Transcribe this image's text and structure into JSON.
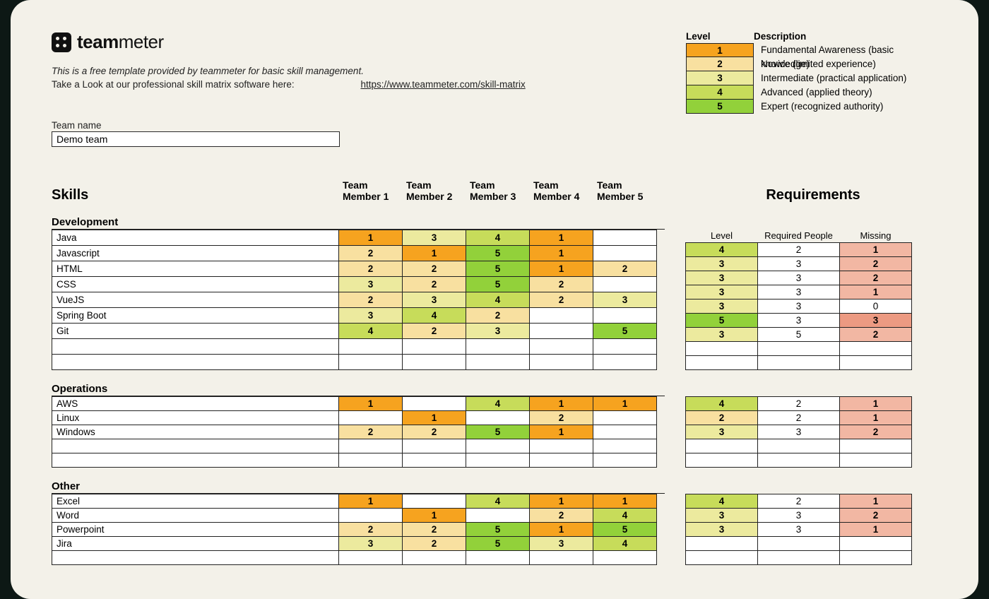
{
  "brand": {
    "bold": "team",
    "light": "meter"
  },
  "intro": {
    "tagline": "This is a free template provided by teammeter for basic skill management.",
    "lookline": "Take a Look at our professional skill matrix software here:",
    "link_text": "https://www.teammeter.com/skill-matrix"
  },
  "team": {
    "label": "Team name",
    "value": "Demo team"
  },
  "legend": {
    "head_level": "Level",
    "head_desc": "Description",
    "rows": [
      {
        "level": "1",
        "desc": "Fundamental Awareness (basic knowledge)",
        "cls": "lv1"
      },
      {
        "level": "2",
        "desc": "Novice (limited experience)",
        "cls": "lv2"
      },
      {
        "level": "3",
        "desc": "Intermediate (practical application)",
        "cls": "lv3"
      },
      {
        "level": "4",
        "desc": "Advanced (applied theory)",
        "cls": "lv4"
      },
      {
        "level": "5",
        "desc": "Expert (recognized authority)",
        "cls": "lv5"
      }
    ]
  },
  "headers": {
    "skills": "Skills",
    "requirements": "Requirements",
    "members": [
      "Team Member 1",
      "Team Member 2",
      "Team Member 3",
      "Team Member 4",
      "Team Member 5"
    ],
    "req_cols": [
      "Level",
      "Required People",
      "Missing"
    ]
  },
  "sections": [
    {
      "name": "Development",
      "rows": [
        {
          "skill": "Java",
          "cells": [
            "1",
            "3",
            "4",
            "1",
            ""
          ],
          "req": [
            "4",
            "2",
            "1"
          ],
          "miss": "miss"
        },
        {
          "skill": "Javascript",
          "cells": [
            "2",
            "1",
            "5",
            "1",
            ""
          ],
          "req": [
            "3",
            "3",
            "2"
          ],
          "miss": "miss"
        },
        {
          "skill": "HTML",
          "cells": [
            "2",
            "2",
            "5",
            "1",
            "2"
          ],
          "req": [
            "3",
            "3",
            "2"
          ],
          "miss": "miss"
        },
        {
          "skill": "CSS",
          "cells": [
            "3",
            "2",
            "5",
            "2",
            ""
          ],
          "req": [
            "3",
            "3",
            "1"
          ],
          "miss": "miss"
        },
        {
          "skill": "VueJS",
          "cells": [
            "2",
            "3",
            "4",
            "2",
            "3"
          ],
          "req": [
            "3",
            "3",
            "0"
          ],
          "miss": "miss0"
        },
        {
          "skill": "Spring Boot",
          "cells": [
            "3",
            "4",
            "2",
            "",
            ""
          ],
          "req": [
            "5",
            "3",
            "3"
          ],
          "miss": "missH"
        },
        {
          "skill": "Git",
          "cells": [
            "4",
            "2",
            "3",
            "",
            "5"
          ],
          "req": [
            "3",
            "5",
            "2"
          ],
          "miss": "miss"
        },
        {
          "skill": "",
          "cells": [
            "",
            "",
            "",
            "",
            ""
          ],
          "req": [
            "",
            "",
            ""
          ],
          "miss": ""
        },
        {
          "skill": "",
          "cells": [
            "",
            "",
            "",
            "",
            ""
          ],
          "req": [
            "",
            "",
            ""
          ],
          "miss": ""
        }
      ]
    },
    {
      "name": "Operations",
      "rows": [
        {
          "skill": "AWS",
          "cells": [
            "1",
            "",
            "4",
            "1",
            "1"
          ],
          "req": [
            "4",
            "2",
            "1"
          ],
          "miss": "miss"
        },
        {
          "skill": "Linux",
          "cells": [
            "",
            "1",
            "",
            "2",
            ""
          ],
          "req": [
            "2",
            "2",
            "1"
          ],
          "miss": "miss"
        },
        {
          "skill": "Windows",
          "cells": [
            "2",
            "2",
            "5",
            "1",
            ""
          ],
          "req": [
            "3",
            "3",
            "2"
          ],
          "miss": "miss"
        },
        {
          "skill": "",
          "cells": [
            "",
            "",
            "",
            "",
            ""
          ],
          "req": [
            "",
            "",
            ""
          ],
          "miss": ""
        },
        {
          "skill": "",
          "cells": [
            "",
            "",
            "",
            "",
            ""
          ],
          "req": [
            "",
            "",
            ""
          ],
          "miss": ""
        }
      ]
    },
    {
      "name": "Other",
      "rows": [
        {
          "skill": "Excel",
          "cells": [
            "1",
            "",
            "4",
            "1",
            "1"
          ],
          "req": [
            "4",
            "2",
            "1"
          ],
          "miss": "miss"
        },
        {
          "skill": "Word",
          "cells": [
            "",
            "1",
            "",
            "2",
            "4"
          ],
          "req": [
            "3",
            "3",
            "2"
          ],
          "miss": "miss"
        },
        {
          "skill": "Powerpoint",
          "cells": [
            "2",
            "2",
            "5",
            "1",
            "5"
          ],
          "req": [
            "3",
            "3",
            "1"
          ],
          "miss": "miss"
        },
        {
          "skill": "Jira",
          "cells": [
            "3",
            "2",
            "5",
            "3",
            "4"
          ],
          "req": [
            "",
            "",
            ""
          ],
          "miss": ""
        },
        {
          "skill": "",
          "cells": [
            "",
            "",
            "",
            "",
            ""
          ],
          "req": [
            "",
            "",
            ""
          ],
          "miss": ""
        }
      ]
    }
  ]
}
